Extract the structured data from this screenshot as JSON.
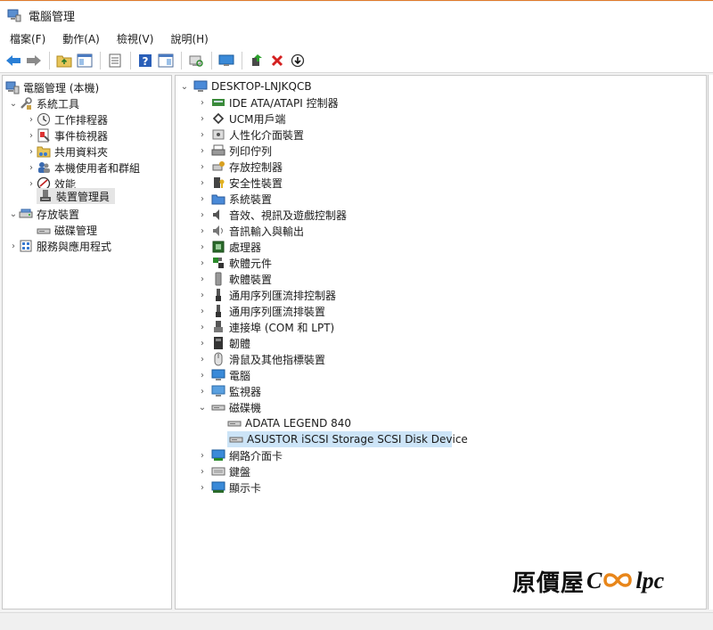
{
  "window": {
    "title": "電腦管理"
  },
  "menu": [
    "檔案(F)",
    "動作(A)",
    "檢視(V)",
    "說明(H)"
  ],
  "toolbar": {
    "buttons": [
      "back-icon",
      "forward-icon",
      "up-folder-icon",
      "show-hide-tree-icon",
      "properties-icon",
      "help-icon",
      "show-action-pane-icon",
      "scan-hardware-icon",
      "display-icon",
      "update-driver-icon",
      "uninstall-icon",
      "disable-icon"
    ]
  },
  "left_tree": {
    "root": "電腦管理 (本機)",
    "system_tools": "系統工具",
    "task_scheduler": "工作排程器",
    "event_viewer": "事件檢視器",
    "shared_folders": "共用資料夾",
    "local_users": "本機使用者和群組",
    "performance": "效能",
    "device_manager": "裝置管理員",
    "storage": "存放裝置",
    "disk_management": "磁碟管理",
    "services_apps": "服務與應用程式"
  },
  "device_tree": {
    "root": "DESKTOP-LNJKQCB",
    "categories": [
      "IDE ATA/ATAPI 控制器",
      "UCM用戶端",
      "人性化介面裝置",
      "列印佇列",
      "存放控制器",
      "安全性裝置",
      "系統裝置",
      "音效、視訊及遊戲控制器",
      "音訊輸入與輸出",
      "處理器",
      "軟體元件",
      "軟體裝置",
      "通用序列匯流排控制器",
      "通用序列匯流排裝置",
      "連接埠 (COM 和 LPT)",
      "韌體",
      "滑鼠及其他指標裝置",
      "電腦",
      "監視器",
      "磁碟機"
    ],
    "disk_children": [
      "ADATA LEGEND 840",
      "ASUSTOR iSCSI Storage SCSI Disk Device"
    ],
    "after": [
      "網路介面卡",
      "鍵盤",
      "顯示卡"
    ]
  },
  "watermark": {
    "cjk": "原價屋",
    "latin_c": "C",
    "latin_rest": "lpc"
  },
  "colors": {
    "selected_blue": "#cce4f7",
    "selected_grey": "#e5e5e5",
    "title_accent": "#e07a2a"
  }
}
